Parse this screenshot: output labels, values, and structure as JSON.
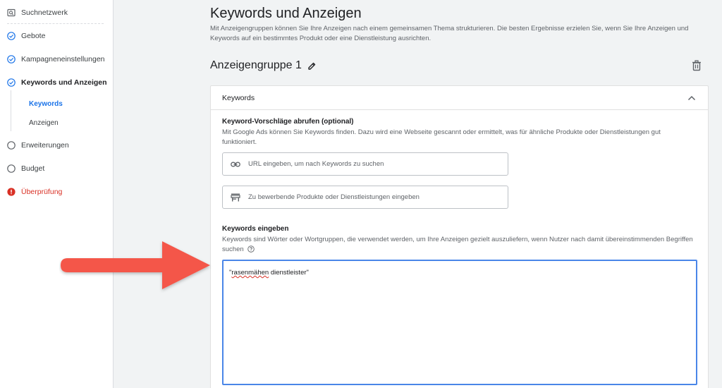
{
  "sidebar": {
    "items": [
      {
        "label": "Suchnetzwerk",
        "icon": "search-network-icon",
        "state": "neutral"
      },
      {
        "label": "Gebote",
        "icon": "check-circle-icon",
        "state": "done"
      },
      {
        "label": "Kampagneneinstellungen",
        "icon": "check-circle-icon",
        "state": "done"
      },
      {
        "label": "Keywords und Anzeigen",
        "icon": "check-circle-icon",
        "state": "active"
      },
      {
        "label": "Erweiterungen",
        "icon": "empty-circle-icon",
        "state": "todo"
      },
      {
        "label": "Budget",
        "icon": "empty-circle-icon",
        "state": "todo"
      },
      {
        "label": "Überprüfung",
        "icon": "error-circle-icon",
        "state": "error"
      }
    ],
    "subitems": [
      {
        "label": "Keywords",
        "active": true
      },
      {
        "label": "Anzeigen",
        "active": false
      }
    ]
  },
  "main": {
    "title": "Keywords und Anzeigen",
    "description": "Mit Anzeigengruppen können Sie Ihre Anzeigen nach einem gemeinsamen Thema strukturieren. Die besten Ergebnisse erzielen Sie, wenn Sie Ihre Anzeigen und Keywords auf ein bestimmtes Produkt oder eine Dienstleistung ausrichten.",
    "ad_group_title": "Anzeigengruppe 1",
    "card": {
      "header": "Keywords",
      "suggestions": {
        "title": "Keyword-Vorschläge abrufen (optional)",
        "description": "Mit Google Ads können Sie Keywords finden. Dazu wird eine Webseite gescannt oder ermittelt, was für ähnliche Produkte oder Dienstleistungen gut funktioniert.",
        "url_placeholder": "URL eingeben, um nach Keywords zu suchen",
        "products_placeholder": "Zu bewerbende Produkte oder Dienstleistungen eingeben"
      },
      "keywords": {
        "title": "Keywords eingeben",
        "description": "Keywords sind Wörter oder Wortgruppen, die verwendet werden, um Ihre Anzeigen gezielt auszuliefern, wenn Nutzer nach damit übereinstimmenden Begriffen suchen",
        "value_prefix": "\"",
        "value_misspelled": "rasenmähen",
        "value_rest": " dienstleister\""
      }
    }
  },
  "colors": {
    "accent": "#1a73e8",
    "error": "#d93025",
    "arrow": "#f4574a",
    "focus_border": "#4a86e8"
  }
}
